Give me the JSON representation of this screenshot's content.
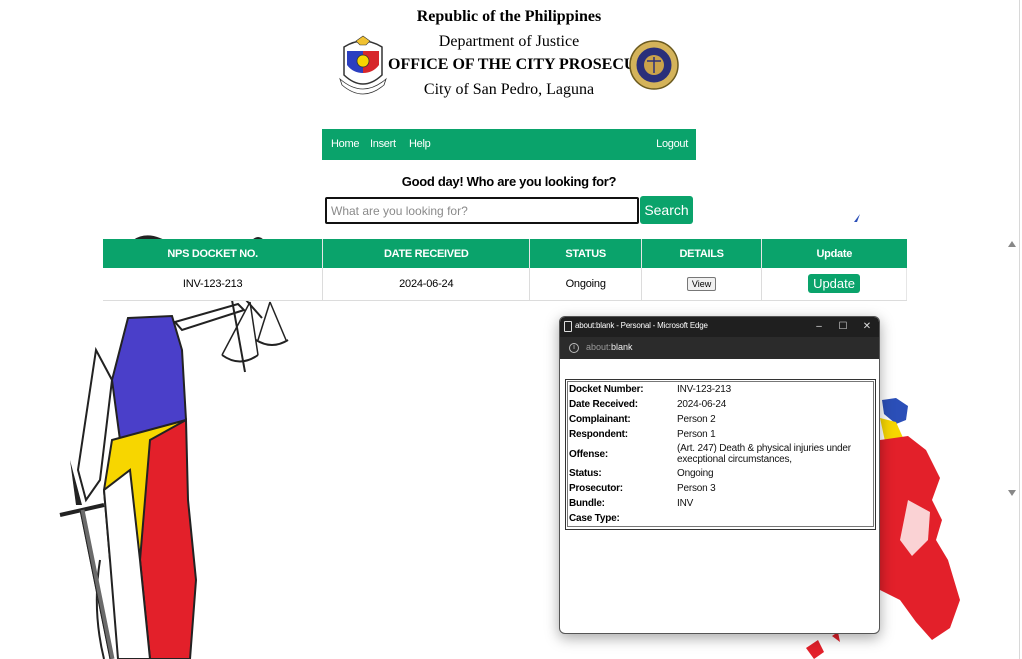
{
  "header": {
    "republic": "Republic of the Philippines",
    "department": "Department of Justice",
    "office": "OFFICE OF THE CITY PROSECUTOR",
    "city": "City of San Pedro, Laguna",
    "left_seal_icon": "philippine-seal-icon",
    "right_seal_icon": "doj-seal-icon"
  },
  "nav": {
    "home": "Home",
    "insert": "Insert",
    "help": "Help",
    "logout": "Logout"
  },
  "greeting": "Good day! Who are you looking for?",
  "search": {
    "placeholder": "What are you looking for?",
    "value": "",
    "button": "Search"
  },
  "table": {
    "headers": [
      "NPS DOCKET NO.",
      "DATE RECEIVED",
      "STATUS",
      "DETAILS",
      "Update"
    ],
    "rows": [
      {
        "docket": "INV-123-213",
        "date": "2024-06-24",
        "status": "Ongoing",
        "details_button": "View",
        "update_button": "Update"
      }
    ]
  },
  "popup": {
    "window_title": "about:blank - Personal - Microsoft Edge",
    "url_scheme": "about:",
    "url_host": "blank",
    "min_glyph": "–",
    "max_glyph": "☐",
    "close_glyph": "✕",
    "details": [
      {
        "label": "Docket Number:",
        "value": "INV-123-213"
      },
      {
        "label": "Date Received:",
        "value": "2024-06-24"
      },
      {
        "label": "Complainant:",
        "value": "Person 2"
      },
      {
        "label": "Respondent:",
        "value": "Person 1"
      },
      {
        "label": "Offense:",
        "value": "(Art. 247) Death & physical injuries under execptional circumstances,"
      },
      {
        "label": "Status:",
        "value": "Ongoing"
      },
      {
        "label": "Prosecutor:",
        "value": "Person 3"
      },
      {
        "label": "Bundle:",
        "value": "INV"
      },
      {
        "label": "Case Type:",
        "value": ""
      }
    ]
  },
  "colors": {
    "accent_green": "#0aa36b",
    "flag_blue": "#4a3fc9",
    "flag_red": "#e3202a",
    "flag_yellow": "#f7d600",
    "titlebar_dark": "#1f1f1f"
  }
}
